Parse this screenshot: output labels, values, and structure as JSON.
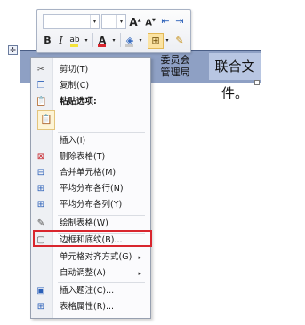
{
  "mini_toolbar": {
    "font_value": "",
    "size_value": "",
    "dropdown_arrow": "▾",
    "grow_font_label": "A",
    "grow_font_sup": "▲",
    "shrink_font_label": "A",
    "shrink_font_sup": "▼",
    "decrease_indent_icon": "⇤",
    "increase_indent_icon": "⇥",
    "bold_label": "B",
    "italic_label": "I",
    "highlight_label": "ab",
    "font_color_label": "A",
    "shading_label": "◈",
    "borders_label": "⊞",
    "format_painter_label": "✎",
    "colors": {
      "highlight": "#f4e33a",
      "font_color": "#d8262e"
    }
  },
  "document": {
    "move_handle_glyph": "✛",
    "table_cell_partial_line1": "委员会",
    "table_cell_partial_line2": "管理局",
    "table_cell_text": "联合文件。"
  },
  "context_menu": {
    "items": [
      {
        "label": "剪切(T)",
        "icon": "scissors-icon",
        "glyph": "✂"
      },
      {
        "label": "复制(C)",
        "icon": "copy-icon",
        "glyph": "❐"
      },
      {
        "label": "粘贴选项:",
        "icon": "paste-icon",
        "glyph": "📋"
      },
      {
        "label": "插入(I)",
        "submenu": "▸"
      },
      {
        "label": "删除表格(T)",
        "icon": "delete-table-icon",
        "glyph": "⊠"
      },
      {
        "label": "合并单元格(M)",
        "icon": "merge-cells-icon",
        "glyph": "⊟"
      },
      {
        "label": "平均分布各行(N)",
        "icon": "distribute-rows-icon",
        "glyph": "⊞"
      },
      {
        "label": "平均分布各列(Y)",
        "icon": "distribute-columns-icon",
        "glyph": "⊞"
      },
      {
        "label": "绘制表格(W)",
        "icon": "draw-table-icon",
        "glyph": "✎"
      },
      {
        "label": "边框和底纹(B)...",
        "icon": "borders-shading-icon",
        "glyph": "▢"
      },
      {
        "label": "单元格对齐方式(G)",
        "submenu": "▸"
      },
      {
        "label": "自动调整(A)",
        "submenu": "▸"
      },
      {
        "label": "插入题注(C)...",
        "icon": "insert-caption-icon",
        "glyph": "▣"
      },
      {
        "label": "表格属性(R)...",
        "icon": "table-properties-icon",
        "glyph": "⊞"
      }
    ],
    "paste_option_glyph": "📋",
    "highlight_color": "#d9262e"
  }
}
